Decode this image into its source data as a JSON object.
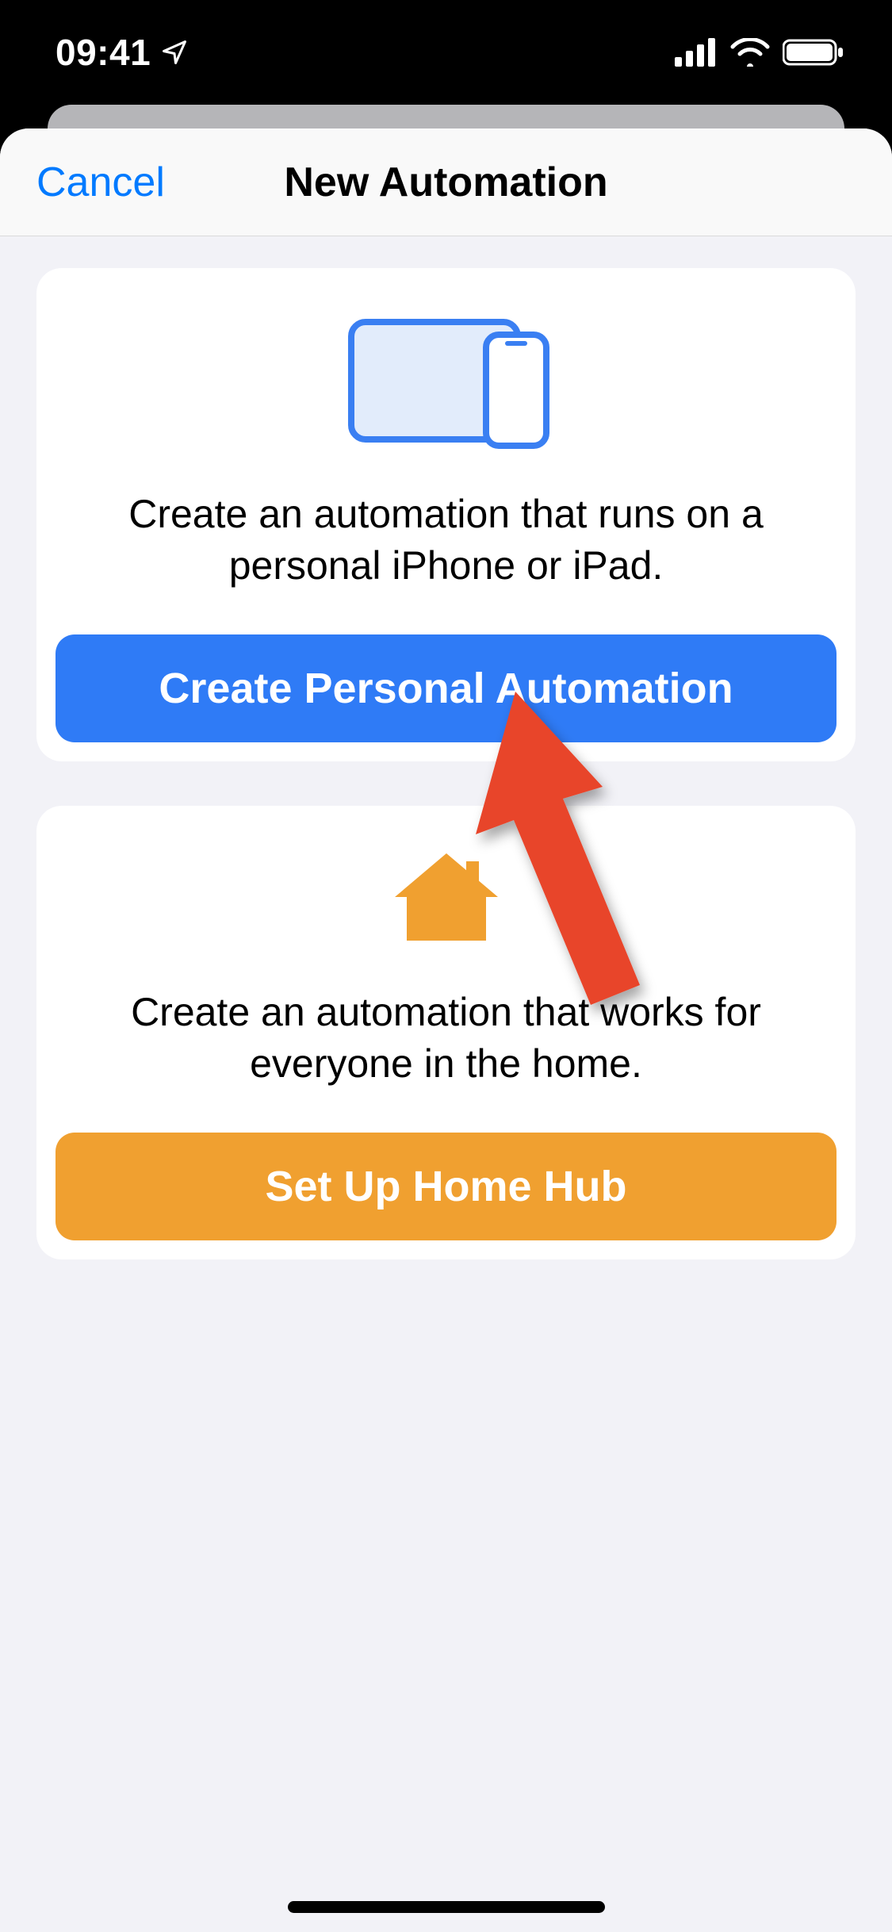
{
  "status_bar": {
    "time": "09:41"
  },
  "nav": {
    "cancel": "Cancel",
    "title": "New Automation"
  },
  "cards": {
    "personal": {
      "description": "Create an automation that runs on a personal iPhone or iPad.",
      "button_label": "Create Personal Automation"
    },
    "home": {
      "description": "Create an automation that works for everyone in the home.",
      "button_label": "Set Up Home Hub"
    }
  },
  "colors": {
    "accent_blue": "#2f7bf6",
    "accent_orange": "#f0a030",
    "link_blue": "#007aff"
  }
}
